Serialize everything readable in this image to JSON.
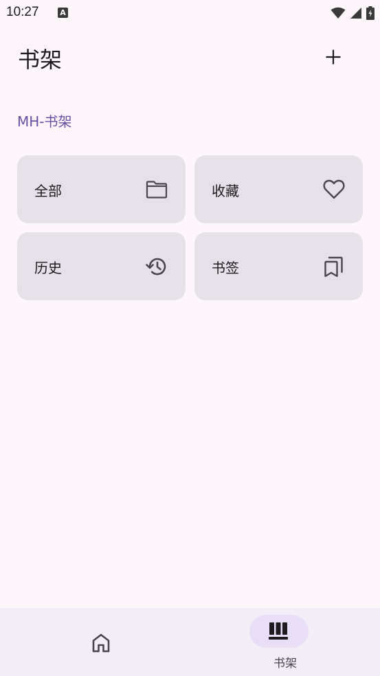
{
  "status_bar": {
    "time": "10:27",
    "notification_badge": "A",
    "icons": [
      "wifi-icon",
      "signal-icon",
      "battery-charging-icon"
    ]
  },
  "app_bar": {
    "title": "书架",
    "action_icon": "add-icon"
  },
  "section": {
    "label": "MH-书架"
  },
  "cards": [
    {
      "label": "全部",
      "icon": "folder-icon"
    },
    {
      "label": "收藏",
      "icon": "heart-icon"
    },
    {
      "label": "历史",
      "icon": "history-icon"
    },
    {
      "label": "书签",
      "icon": "bookmarks-icon"
    }
  ],
  "bottom_nav": {
    "items": [
      {
        "label": "",
        "icon": "home-icon",
        "selected": false
      },
      {
        "label": "书架",
        "icon": "shelf-icon",
        "selected": true
      }
    ]
  },
  "colors": {
    "background": "#FDF7FC",
    "accent": "#6750A4",
    "card": "#E6E0E9",
    "nav_background": "#F3EDF7",
    "nav_indicator": "#E8DEF8"
  }
}
